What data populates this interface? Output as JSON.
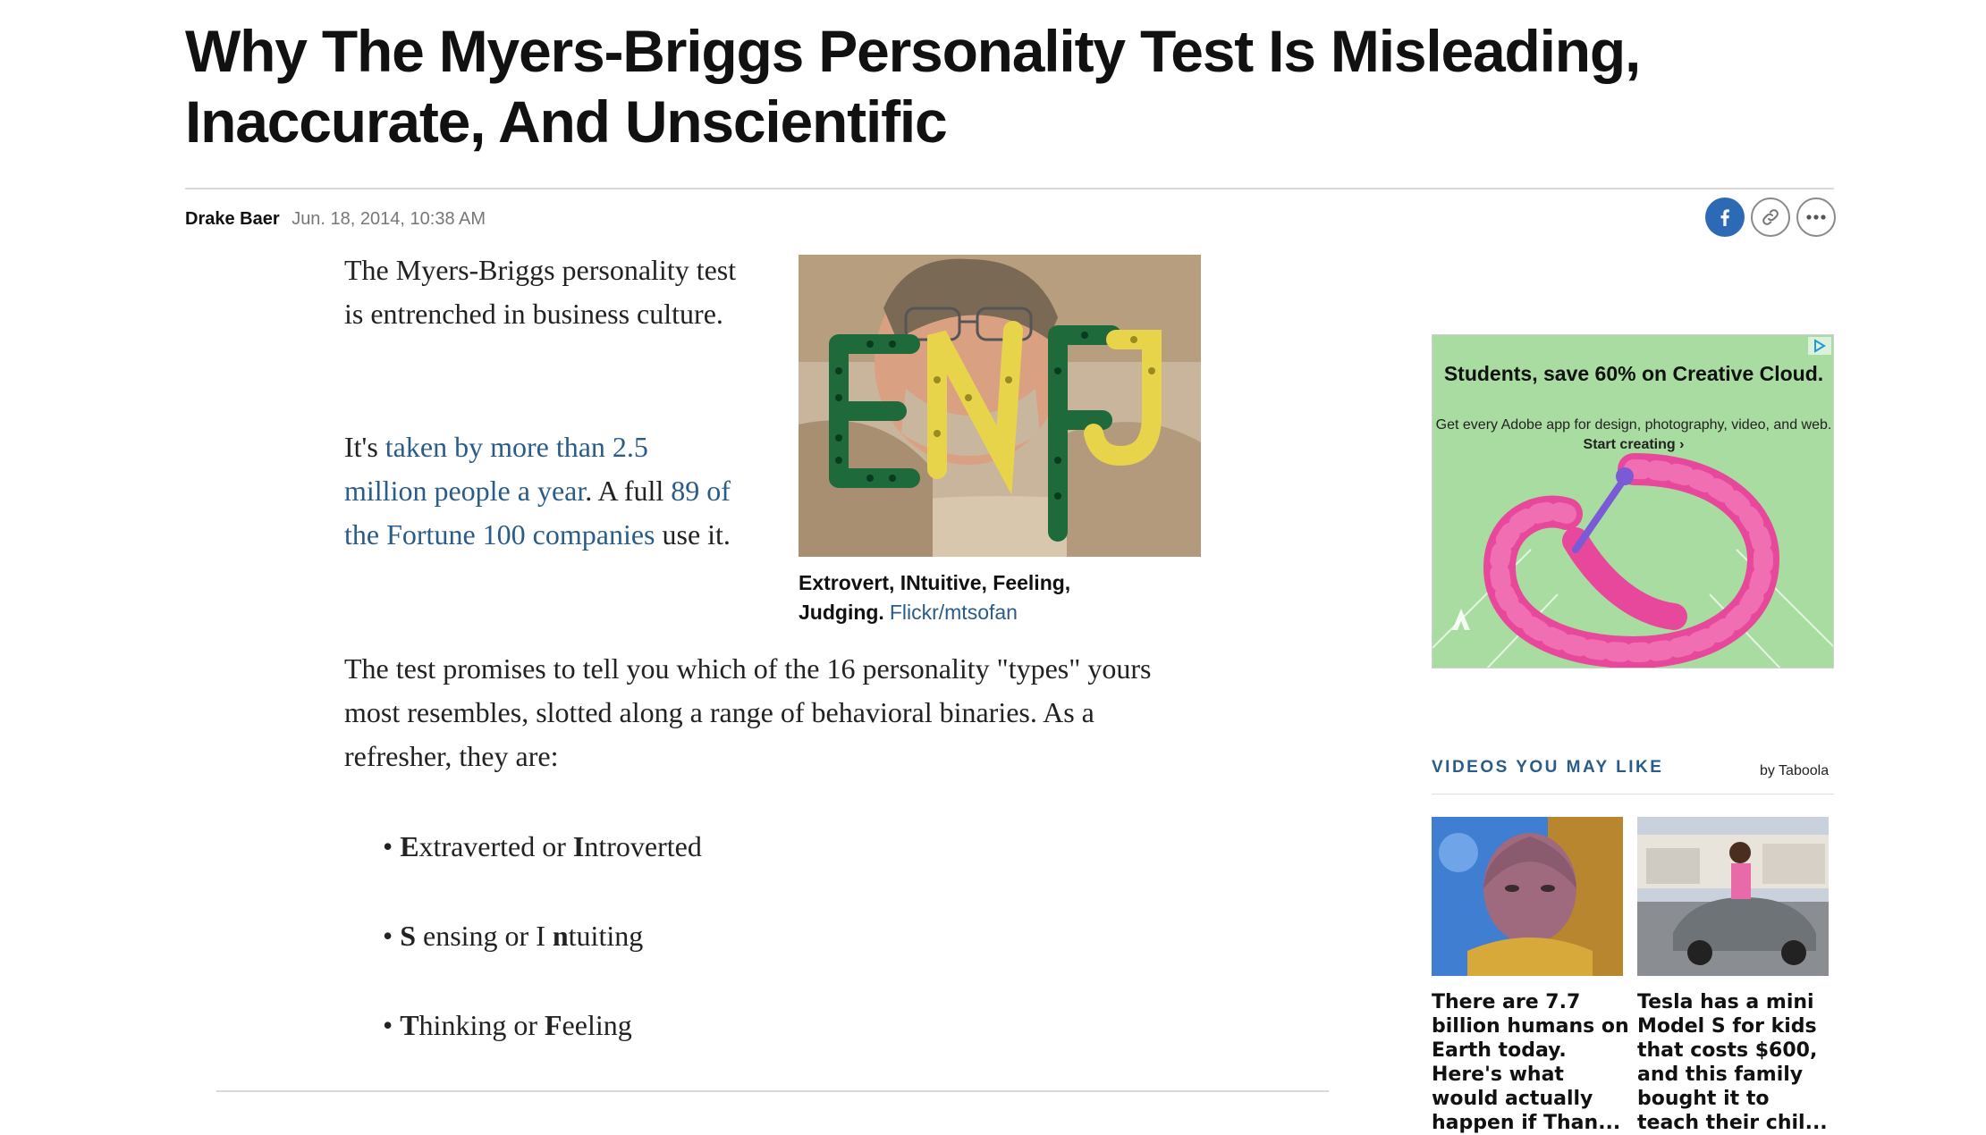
{
  "article": {
    "headline": "Why The Myers-Briggs Personality Test Is Misleading, Inaccurate, And Unscientific",
    "author": "Drake Baer",
    "date": "Jun. 18, 2014, 10:38 AM",
    "p1": "The Myers-Briggs personality test is entrenched in business culture.",
    "p2_a": "It's ",
    "p2_link1": "taken by more than 2.5 million people a year",
    "p2_b": ". A full ",
    "p2_link2": "89 of the Fortune 100 companies",
    "p2_c": " use it.",
    "p3": "The test promises to tell you which of the 16 personality \"types\" yours most resembles, slotted along a range of behavioral binaries. As a refresher, they are:",
    "bullet_dot": "•",
    "bullets": [
      {
        "l1": "E",
        "r1": "xtraverted or ",
        "l2": "I",
        "r2": "ntroverted"
      },
      {
        "l1": "S",
        "r1": " ensing or I ",
        "l2": "n",
        "r2": "tuiting"
      },
      {
        "l1": "T",
        "r1": "hinking or ",
        "l2": "F",
        "r2": "eeling"
      }
    ],
    "image_caption": "Extrovert, INtuitive, Feeling, Judging.",
    "image_credit": "Flickr/mtsofan",
    "image_letters": "ENFJ"
  },
  "share": {
    "facebook_icon": "facebook-icon",
    "link_icon": "link-icon",
    "more_icon": "more-icon"
  },
  "ad": {
    "title": "Students, save 60% on Creative Cloud.",
    "subtitle": "Get every Adobe app for design, photography, video, and web.",
    "cta": "Start creating ›",
    "brand": "Adobe",
    "background_color": "#a9dca0"
  },
  "videos": {
    "header": "VIDEOS YOU MAY LIKE",
    "provider": "by Taboola",
    "items": [
      {
        "title": "There are 7.7 billion humans on Earth today. Here's what would actually happen if Than..."
      },
      {
        "title": "Tesla has a mini Model S for kids that costs $600, and this family bought it to teach their chil..."
      }
    ]
  },
  "colors": {
    "link": "#2a5c8a",
    "facebook": "#2d6ab6"
  }
}
